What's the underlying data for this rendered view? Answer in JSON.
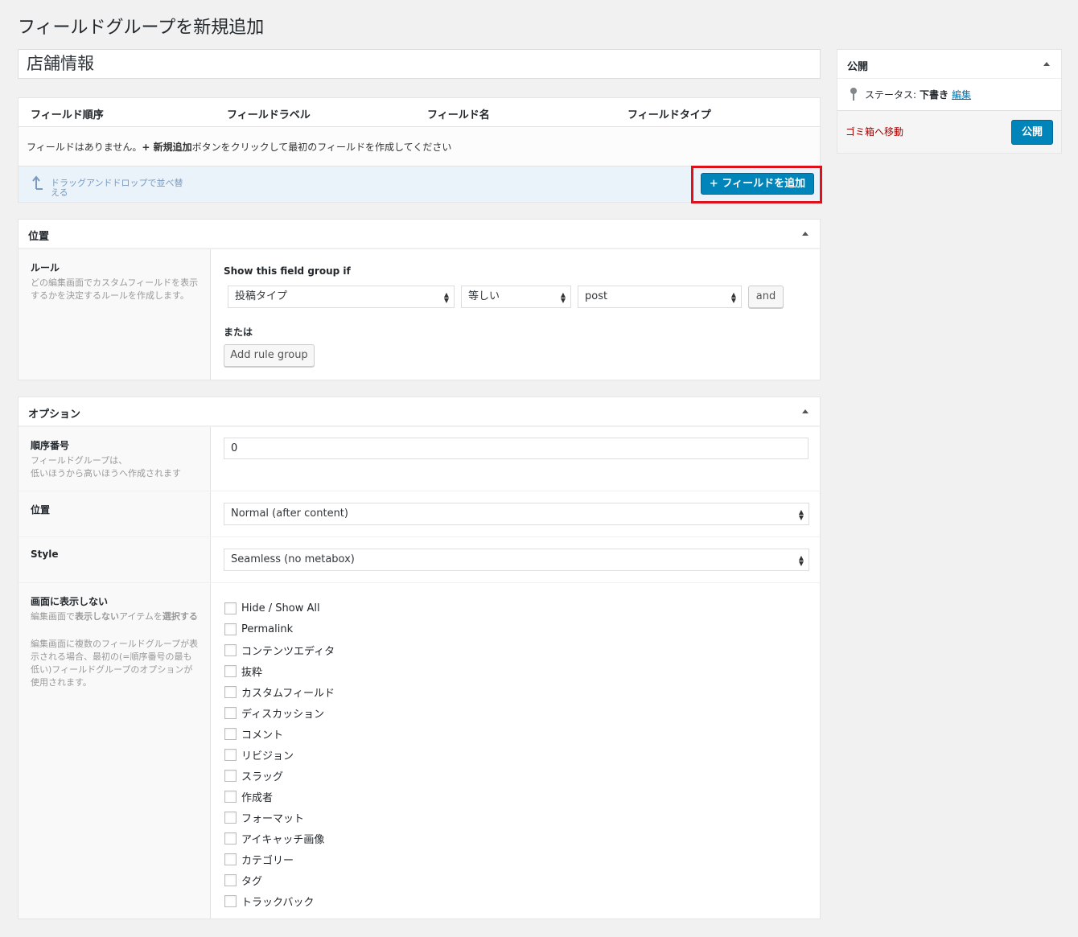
{
  "page": {
    "title": "フィールドグループを新規追加",
    "group_title": "店舗情報"
  },
  "fields": {
    "columns": [
      "フィールド順序",
      "フィールドラベル",
      "フィールド名",
      "フィールドタイプ"
    ],
    "empty_prefix": "フィールドはありません。",
    "empty_strong": "+ 新規追加",
    "empty_suffix": "ボタンをクリックして最初のフィールドを作成してください",
    "drag_hint": "ドラッグアンドドロップで並べ替える",
    "add_button": "+ フィールドを追加"
  },
  "location": {
    "title": "位置",
    "rules_label": "ルール",
    "rules_desc": "どの編集画面でカスタムフィールドを表示するかを決定するルールを作成します。",
    "show_if": "Show this field group if",
    "param": "投稿タイプ",
    "operator": "等しい",
    "value": "post",
    "and_button": "and",
    "or_label": "または",
    "add_group_button": "Add rule group"
  },
  "options": {
    "title": "オプション",
    "order_label": "順序番号",
    "order_desc": "フィールドグループは、\n低いほうから高いほうへ作成されます",
    "order_value": "0",
    "position_label": "位置",
    "position_value": "Normal (after content)",
    "style_label": "Style",
    "style_value": "Seamless (no metabox)",
    "hide_label": "画面に表示しない",
    "hide_desc1_a": "編集画面で",
    "hide_desc1_b": "表示しない",
    "hide_desc1_c": "アイテムを",
    "hide_desc1_d": "選択する",
    "hide_desc2": "編集画面に複数のフィールドグループが表示される場合、最初の(=順序番号の最も低い)フィールドグループのオプションが使用されます。",
    "hide_items": [
      "Hide / Show All",
      "Permalink",
      "コンテンツエディタ",
      "抜粋",
      "カスタムフィールド",
      "ディスカッション",
      "コメント",
      "リビジョン",
      "スラッグ",
      "作成者",
      "フォーマット",
      "アイキャッチ画像",
      "カテゴリー",
      "タグ",
      "トラックバック"
    ]
  },
  "publish": {
    "title": "公開",
    "status_label": "ステータス:",
    "status_value": "下書き",
    "edit_link": "編集",
    "trash_link": "ゴミ箱へ移動",
    "publish_button": "公開"
  },
  "colors": {
    "primary": "#0085ba",
    "highlight": "#e0101a",
    "trash": "#aa0000"
  }
}
